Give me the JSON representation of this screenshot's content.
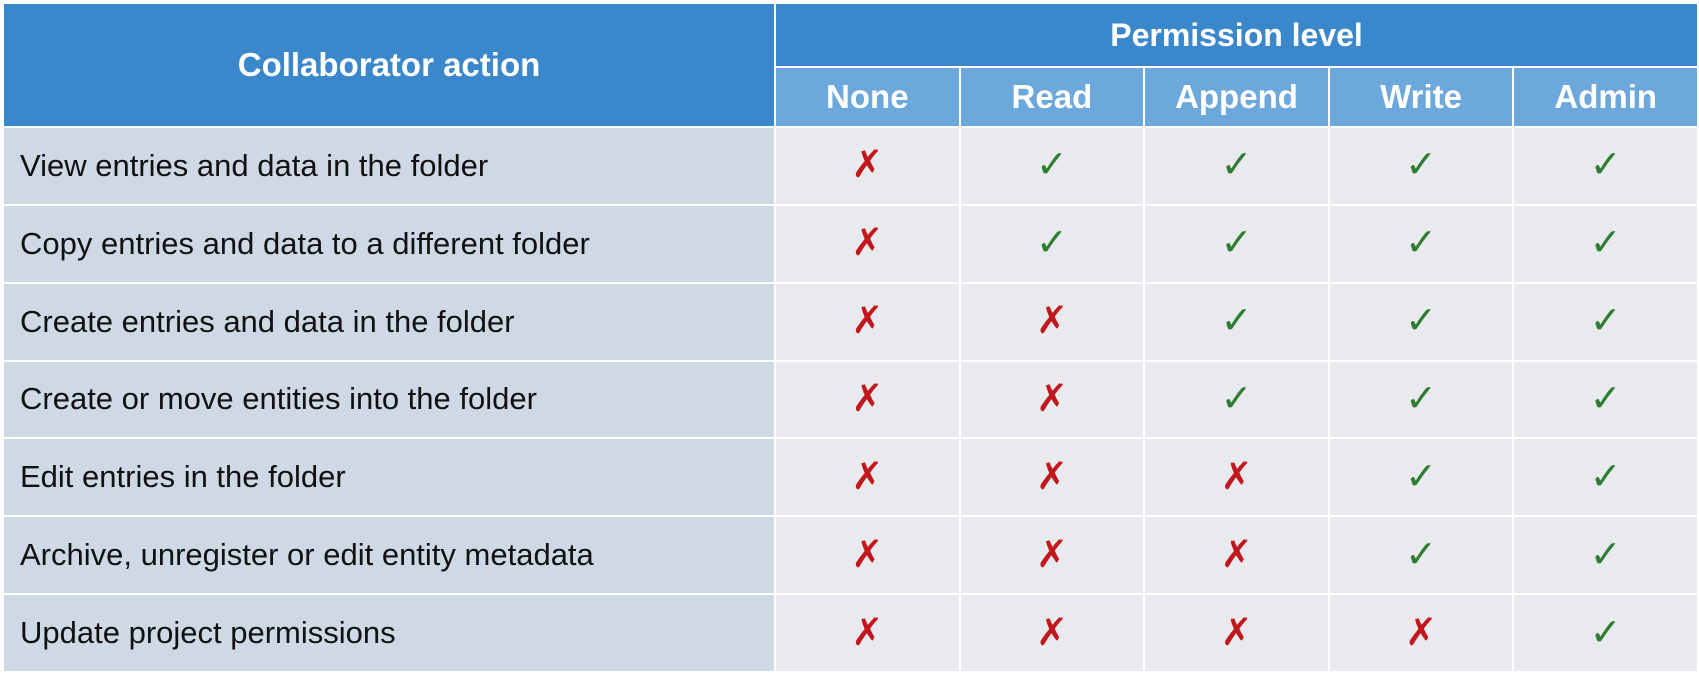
{
  "table": {
    "action_header": "Collaborator action",
    "group_header": "Permission level",
    "levels": [
      "None",
      "Read",
      "Append",
      "Write",
      "Admin"
    ],
    "rows": [
      {
        "action": "View entries and data in the folder",
        "allowed": [
          false,
          true,
          true,
          true,
          true
        ]
      },
      {
        "action": "Copy entries and data to a different folder",
        "allowed": [
          false,
          true,
          true,
          true,
          true
        ]
      },
      {
        "action": "Create entries and data in the folder",
        "allowed": [
          false,
          false,
          true,
          true,
          true
        ]
      },
      {
        "action": "Create or move entities into the folder",
        "allowed": [
          false,
          false,
          true,
          true,
          true
        ]
      },
      {
        "action": "Edit entries in the folder",
        "allowed": [
          false,
          false,
          false,
          true,
          true
        ]
      },
      {
        "action": "Archive, unregister or edit entity metadata",
        "allowed": [
          false,
          false,
          false,
          true,
          true
        ]
      },
      {
        "action": "Update project permissions",
        "allowed": [
          false,
          false,
          false,
          false,
          true
        ]
      }
    ]
  },
  "marks": {
    "allowed_icon": "check-icon",
    "denied_icon": "cross-icon",
    "allowed_glyph": "✓",
    "denied_glyph": "✗",
    "allowed_color": "#2e7d32",
    "denied_color": "#c0181c"
  },
  "colors": {
    "header_bg": "#3a87cc",
    "subheader_bg": "#6da8dc",
    "action_cell_bg": "#cfd9e6",
    "mark_cell_bg": "#e8eaed"
  }
}
